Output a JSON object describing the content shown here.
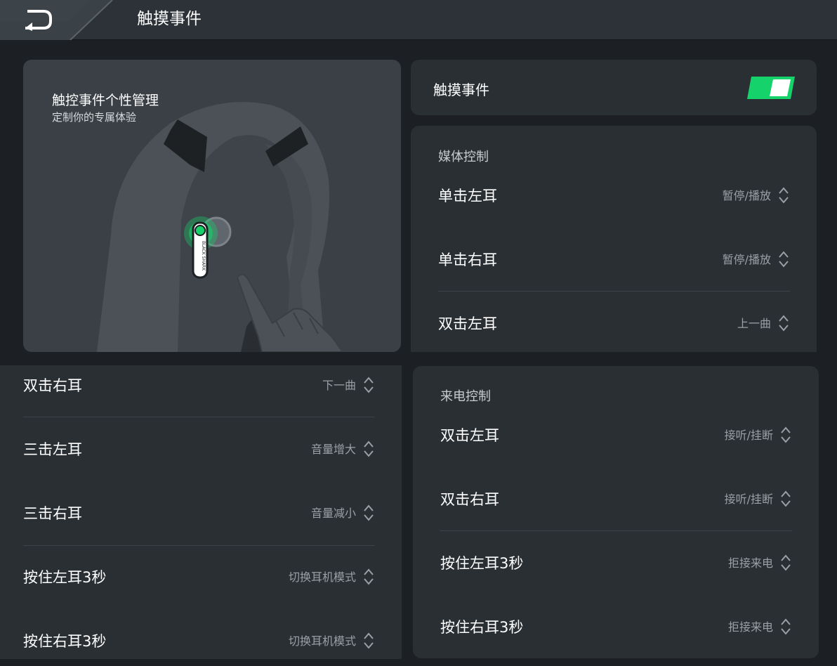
{
  "header": {
    "title": "触摸事件"
  },
  "hero": {
    "title": "触控事件个性管理",
    "subtitle": "定制你的专属体验",
    "earbud_brand": "BLACK SHARK"
  },
  "toggle": {
    "label": "触摸事件",
    "enabled": true,
    "accent_color": "#15d36a"
  },
  "media_control": {
    "title": "媒体控制",
    "rows": [
      {
        "label": "单击左耳",
        "value": "暂停/播放"
      },
      {
        "label": "单击右耳",
        "value": "暂停/播放"
      },
      {
        "label": "双击左耳",
        "value": "上一曲"
      }
    ]
  },
  "media_control_continued": {
    "rows": [
      {
        "label": "双击右耳",
        "value": "下一曲"
      },
      {
        "label": "三击左耳",
        "value": "音量增大"
      },
      {
        "label": "三击右耳",
        "value": "音量减小"
      },
      {
        "label": "按住左耳3秒",
        "value": "切换耳机模式"
      },
      {
        "label": "按住右耳3秒",
        "value": "切换耳机模式"
      }
    ]
  },
  "call_control": {
    "title": "来电控制",
    "rows": [
      {
        "label": "双击左耳",
        "value": "接听/挂断"
      },
      {
        "label": "双击右耳",
        "value": "接听/挂断"
      },
      {
        "label": "按住左耳3秒",
        "value": "拒接来电"
      },
      {
        "label": "按住右耳3秒",
        "value": "拒接来电"
      }
    ]
  },
  "icons": {
    "back": "back-arrow-icon",
    "chevron": "chevron-up-down-icon"
  }
}
